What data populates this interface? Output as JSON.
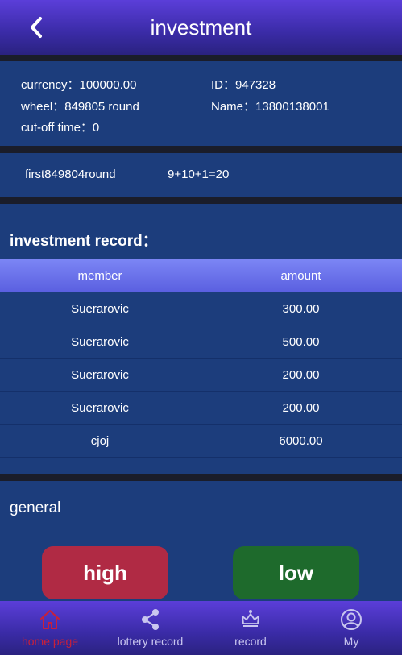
{
  "header": {
    "title": "investment",
    "back_icon": "chevron-left-icon"
  },
  "info": {
    "currency_label": "currency：",
    "currency_value": "100000.00",
    "id_label": "ID：",
    "id_value": "947328",
    "wheel_label": "wheel：",
    "wheel_value": "849805 round",
    "name_label": "Name：",
    "name_value": "13800138001",
    "cutoff_label": "cut-off time：",
    "cutoff_value": "0"
  },
  "round": {
    "label": "first849804round",
    "result": "9+10+1=20"
  },
  "record": {
    "title": "investment record：",
    "columns": [
      "member",
      "amount"
    ],
    "rows": [
      {
        "member": "Suerarovic",
        "amount": "300.00"
      },
      {
        "member": "Suerarovic",
        "amount": "500.00"
      },
      {
        "member": "Suerarovic",
        "amount": "200.00"
      },
      {
        "member": "Suerarovic",
        "amount": "200.00"
      },
      {
        "member": "cjoj",
        "amount": "6000.00"
      }
    ]
  },
  "general": {
    "label": "general",
    "high_label": "high",
    "low_label": "low"
  },
  "tabbar": {
    "items": [
      {
        "label": "home page",
        "icon": "home-icon",
        "active": true
      },
      {
        "label": "lottery record",
        "icon": "share-icon",
        "active": false
      },
      {
        "label": "record",
        "icon": "crown-icon",
        "active": false
      },
      {
        "label": "My",
        "icon": "user-icon",
        "active": false
      }
    ]
  },
  "colors": {
    "header_purple": "#5b3ed9",
    "body_blue": "#1c3d7c",
    "high_red": "#b02a44",
    "low_green": "#1e6a2c",
    "active_tab": "#c8203a"
  }
}
